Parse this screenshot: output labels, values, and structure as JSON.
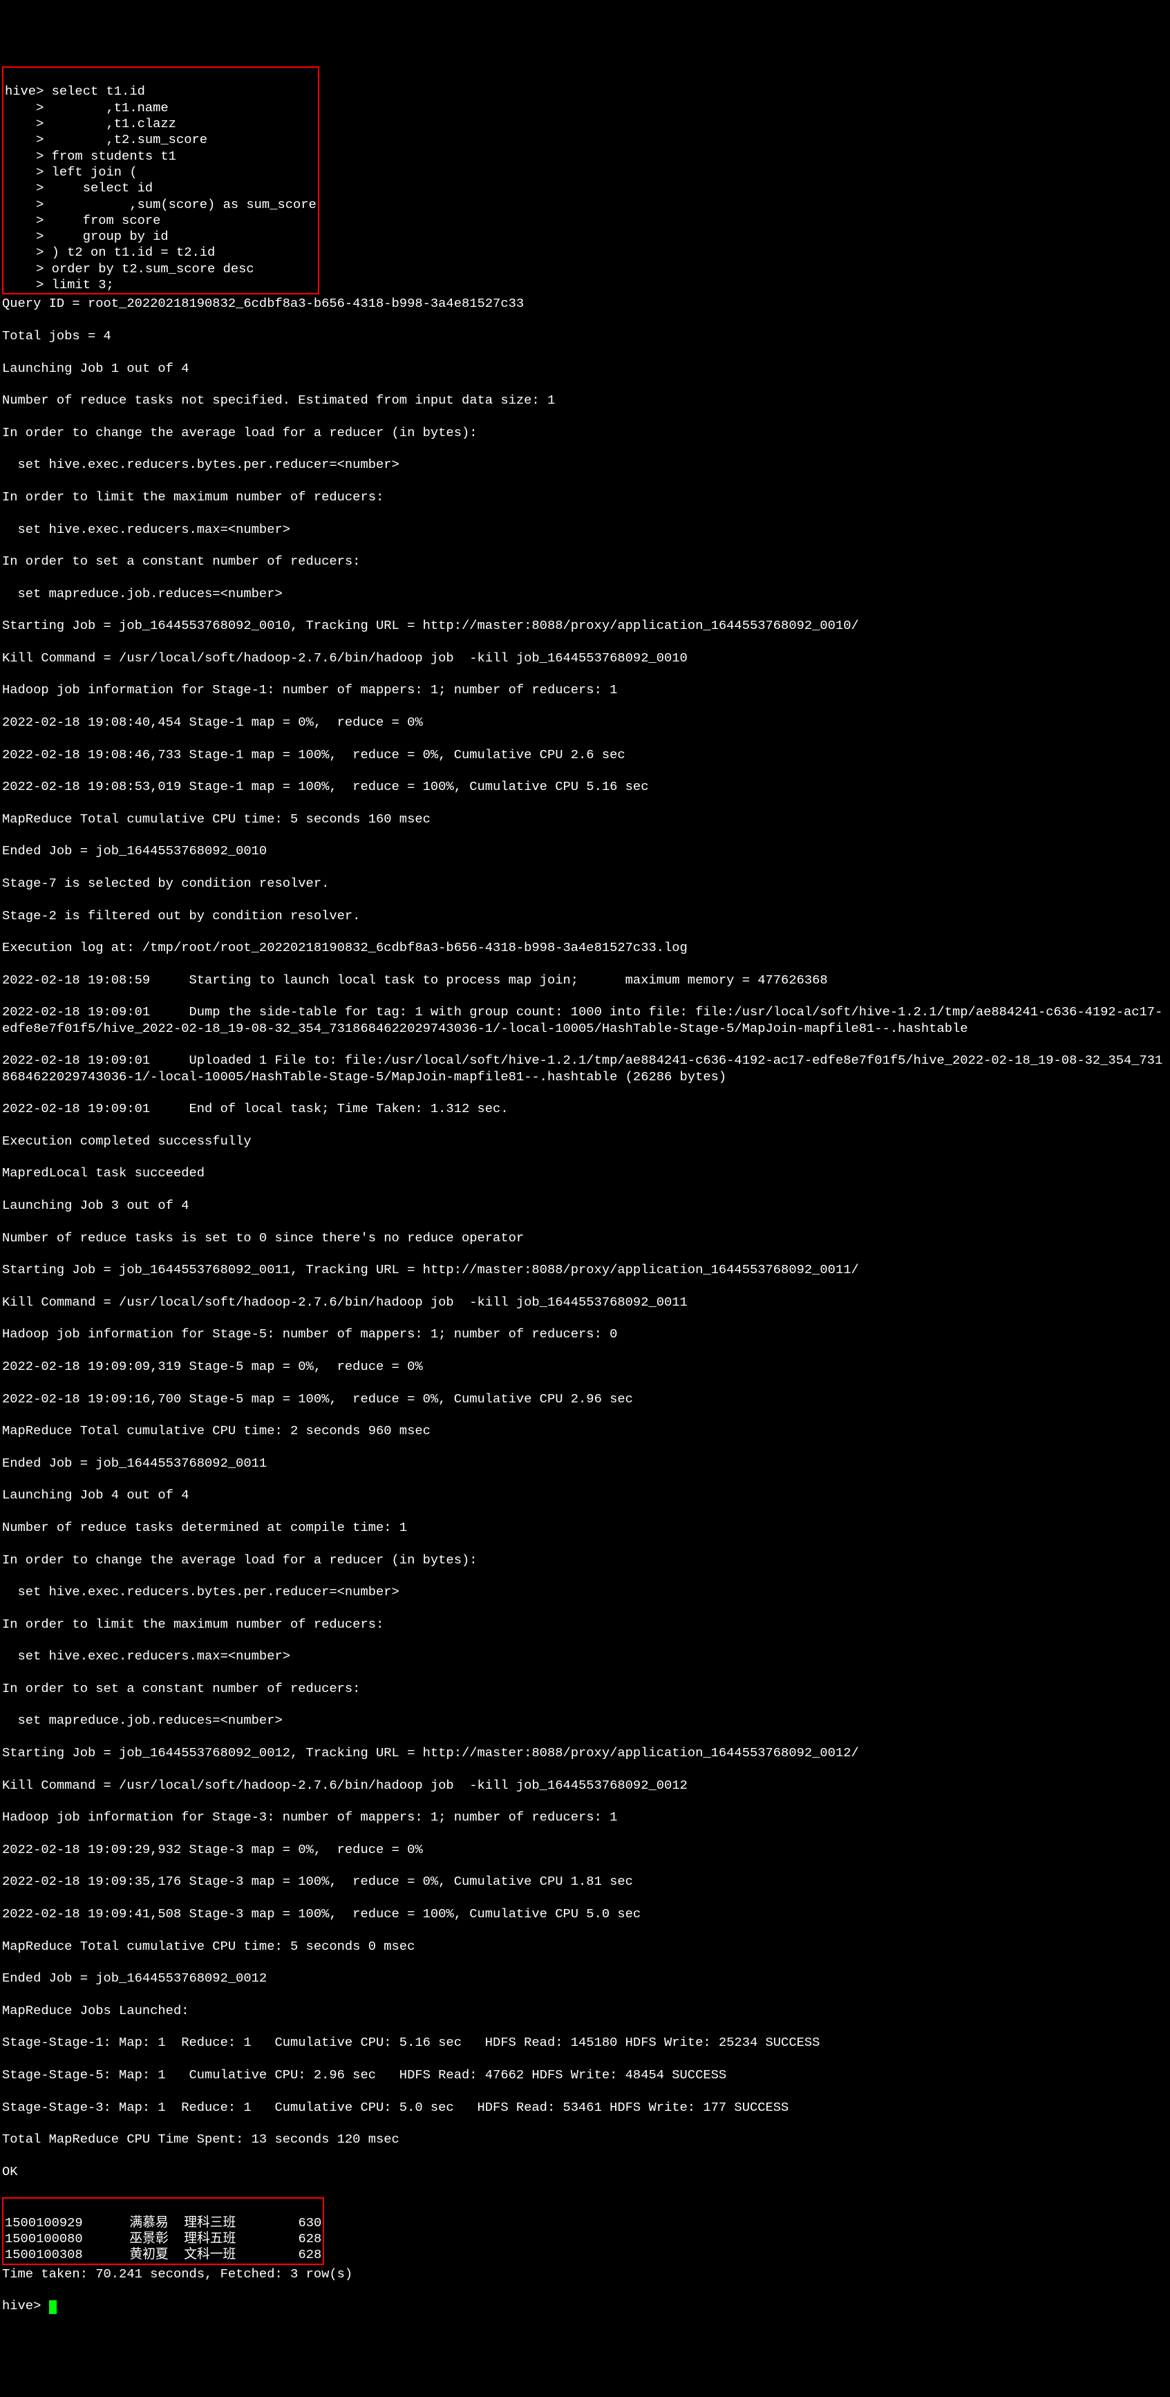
{
  "prompt_main": "hive> ",
  "prompt_cont": "    > ",
  "sql": {
    "l0": "select t1.id",
    "l1": "       ,t1.name",
    "l2": "       ,t1.clazz",
    "l3": "       ,t2.sum_score",
    "l4": "from students t1",
    "l5": "left join (",
    "l6": "    select id",
    "l7": "          ,sum(score) as sum_score",
    "l8": "    from score",
    "l9": "    group by id",
    "l10": ") t2 on t1.id = t2.id",
    "l11": "order by t2.sum_score desc",
    "l12": "limit 3;"
  },
  "log": {
    "l0": "Query ID = root_20220218190832_6cdbf8a3-b656-4318-b998-3a4e81527c33",
    "l1": "Total jobs = 4",
    "l2": "Launching Job 1 out of 4",
    "l3": "Number of reduce tasks not specified. Estimated from input data size: 1",
    "l4": "In order to change the average load for a reducer (in bytes):",
    "l5": "  set hive.exec.reducers.bytes.per.reducer=<number>",
    "l6": "In order to limit the maximum number of reducers:",
    "l7": "  set hive.exec.reducers.max=<number>",
    "l8": "In order to set a constant number of reducers:",
    "l9": "  set mapreduce.job.reduces=<number>",
    "l10": "Starting Job = job_1644553768092_0010, Tracking URL = http://master:8088/proxy/application_1644553768092_0010/",
    "l11": "Kill Command = /usr/local/soft/hadoop-2.7.6/bin/hadoop job  -kill job_1644553768092_0010",
    "l12": "Hadoop job information for Stage-1: number of mappers: 1; number of reducers: 1",
    "l13": "2022-02-18 19:08:40,454 Stage-1 map = 0%,  reduce = 0%",
    "l14": "2022-02-18 19:08:46,733 Stage-1 map = 100%,  reduce = 0%, Cumulative CPU 2.6 sec",
    "l15": "2022-02-18 19:08:53,019 Stage-1 map = 100%,  reduce = 100%, Cumulative CPU 5.16 sec",
    "l16": "MapReduce Total cumulative CPU time: 5 seconds 160 msec",
    "l17": "Ended Job = job_1644553768092_0010",
    "l18": "Stage-7 is selected by condition resolver.",
    "l19": "Stage-2 is filtered out by condition resolver.",
    "l20": "Execution log at: /tmp/root/root_20220218190832_6cdbf8a3-b656-4318-b998-3a4e81527c33.log",
    "l21": "2022-02-18 19:08:59     Starting to launch local task to process map join;      maximum memory = 477626368",
    "l22": "2022-02-18 19:09:01     Dump the side-table for tag: 1 with group count: 1000 into file: file:/usr/local/soft/hive-1.2.1/tmp/ae884241-c636-4192-ac17-edfe8e7f01f5/hive_2022-02-18_19-08-32_354_7318684622029743036-1/-local-10005/HashTable-Stage-5/MapJoin-mapfile81--.hashtable",
    "l23": "2022-02-18 19:09:01     Uploaded 1 File to: file:/usr/local/soft/hive-1.2.1/tmp/ae884241-c636-4192-ac17-edfe8e7f01f5/hive_2022-02-18_19-08-32_354_7318684622029743036-1/-local-10005/HashTable-Stage-5/MapJoin-mapfile81--.hashtable (26286 bytes)",
    "l24": "2022-02-18 19:09:01     End of local task; Time Taken: 1.312 sec.",
    "l25": "Execution completed successfully",
    "l26": "MapredLocal task succeeded",
    "l27": "Launching Job 3 out of 4",
    "l28": "Number of reduce tasks is set to 0 since there's no reduce operator",
    "l29": "Starting Job = job_1644553768092_0011, Tracking URL = http://master:8088/proxy/application_1644553768092_0011/",
    "l30": "Kill Command = /usr/local/soft/hadoop-2.7.6/bin/hadoop job  -kill job_1644553768092_0011",
    "l31": "Hadoop job information for Stage-5: number of mappers: 1; number of reducers: 0",
    "l32": "2022-02-18 19:09:09,319 Stage-5 map = 0%,  reduce = 0%",
    "l33": "2022-02-18 19:09:16,700 Stage-5 map = 100%,  reduce = 0%, Cumulative CPU 2.96 sec",
    "l34": "MapReduce Total cumulative CPU time: 2 seconds 960 msec",
    "l35": "Ended Job = job_1644553768092_0011",
    "l36": "Launching Job 4 out of 4",
    "l37": "Number of reduce tasks determined at compile time: 1",
    "l38": "In order to change the average load for a reducer (in bytes):",
    "l39": "  set hive.exec.reducers.bytes.per.reducer=<number>",
    "l40": "In order to limit the maximum number of reducers:",
    "l41": "  set hive.exec.reducers.max=<number>",
    "l42": "In order to set a constant number of reducers:",
    "l43": "  set mapreduce.job.reduces=<number>",
    "l44": "Starting Job = job_1644553768092_0012, Tracking URL = http://master:8088/proxy/application_1644553768092_0012/",
    "l45": "Kill Command = /usr/local/soft/hadoop-2.7.6/bin/hadoop job  -kill job_1644553768092_0012",
    "l46": "Hadoop job information for Stage-3: number of mappers: 1; number of reducers: 1",
    "l47": "2022-02-18 19:09:29,932 Stage-3 map = 0%,  reduce = 0%",
    "l48": "2022-02-18 19:09:35,176 Stage-3 map = 100%,  reduce = 0%, Cumulative CPU 1.81 sec",
    "l49": "2022-02-18 19:09:41,508 Stage-3 map = 100%,  reduce = 100%, Cumulative CPU 5.0 sec",
    "l50": "MapReduce Total cumulative CPU time: 5 seconds 0 msec",
    "l51": "Ended Job = job_1644553768092_0012",
    "l52": "MapReduce Jobs Launched: ",
    "l53": "Stage-Stage-1: Map: 1  Reduce: 1   Cumulative CPU: 5.16 sec   HDFS Read: 145180 HDFS Write: 25234 SUCCESS",
    "l54": "Stage-Stage-5: Map: 1   Cumulative CPU: 2.96 sec   HDFS Read: 47662 HDFS Write: 48454 SUCCESS",
    "l55": "Stage-Stage-3: Map: 1  Reduce: 1   Cumulative CPU: 5.0 sec   HDFS Read: 53461 HDFS Write: 177 SUCCESS",
    "l56": "Total MapReduce CPU Time Spent: 13 seconds 120 msec",
    "l57": "OK"
  },
  "result": {
    "r0": "1500100929      满慕易  理科三班        630",
    "r1": "1500100080      巫景彰  理科五班        628",
    "r2": "1500100308      黄初夏  文科一班        628"
  },
  "footer": {
    "time": "Time taken: 70.241 seconds, Fetched: 3 row(s)"
  }
}
